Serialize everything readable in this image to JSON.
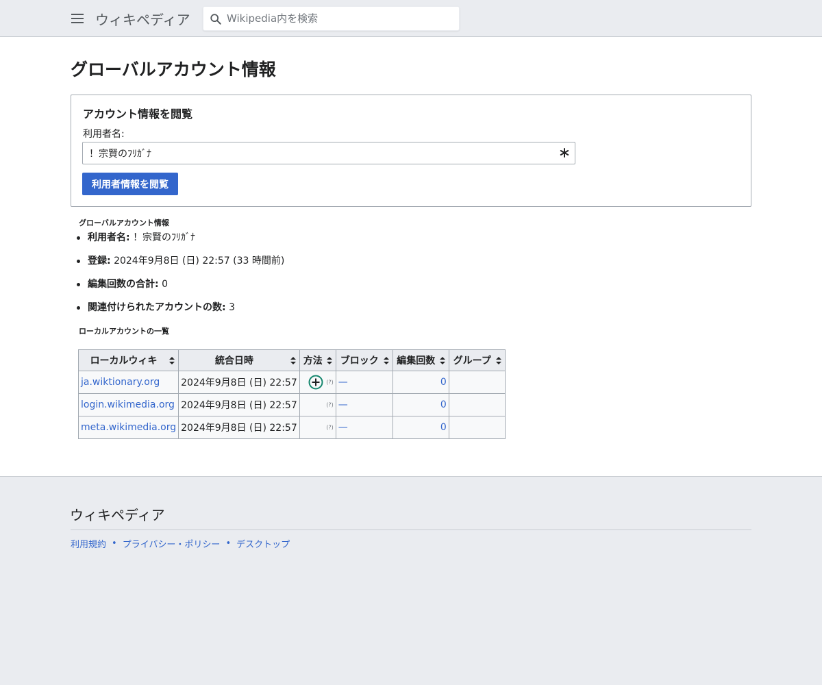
{
  "header": {
    "brand": "ウィキペディア",
    "search_placeholder": "Wikipedia内を検索"
  },
  "page_title": "グローバルアカウント情報",
  "form": {
    "legend": "アカウント情報を閲覧",
    "username_label": "利用者名:",
    "username_value": "！宗賢のﾌﾘｶﾞﾅ",
    "submit_label": "利用者情報を閲覧"
  },
  "global_info": {
    "heading": "グローバルアカウント情報",
    "items": [
      {
        "key": "利用者名:",
        "value": "！宗賢のﾌﾘｶﾞﾅ"
      },
      {
        "key": "登録:",
        "value": "2024年9月8日 (日) 22:57 (33 時間前)"
      },
      {
        "key": "編集回数の合計:",
        "value": "0"
      },
      {
        "key": "関連付けられたアカウントの数:",
        "value": "3"
      }
    ]
  },
  "local_accounts": {
    "heading": "ローカルアカウントの一覧",
    "columns": [
      "ローカルウィキ",
      "統合日時",
      "方法",
      "ブロック",
      "編集回数",
      "グループ"
    ],
    "rows": [
      {
        "wiki": "ja.wiktionary.org",
        "date": "2024年9月8日 (日) 22:57",
        "method_help": "(?)",
        "block": "—",
        "edits": "0",
        "groups": ""
      },
      {
        "wiki": "login.wikimedia.org",
        "date": "2024年9月8日 (日) 22:57",
        "method_help": "(?)",
        "block": "—",
        "edits": "0",
        "groups": ""
      },
      {
        "wiki": "meta.wikimedia.org",
        "date": "2024年9月8日 (日) 22:57",
        "method_help": "(?)",
        "block": "—",
        "edits": "0",
        "groups": ""
      }
    ]
  },
  "footer": {
    "brand": "ウィキペディア",
    "links": [
      "利用規約",
      "プライバシー・ポリシー",
      "デスクトップ"
    ],
    "separator": "•"
  },
  "colors": {
    "link": "#3366cc",
    "primary_button": "#3366cc",
    "method_icon": "#14866d"
  }
}
